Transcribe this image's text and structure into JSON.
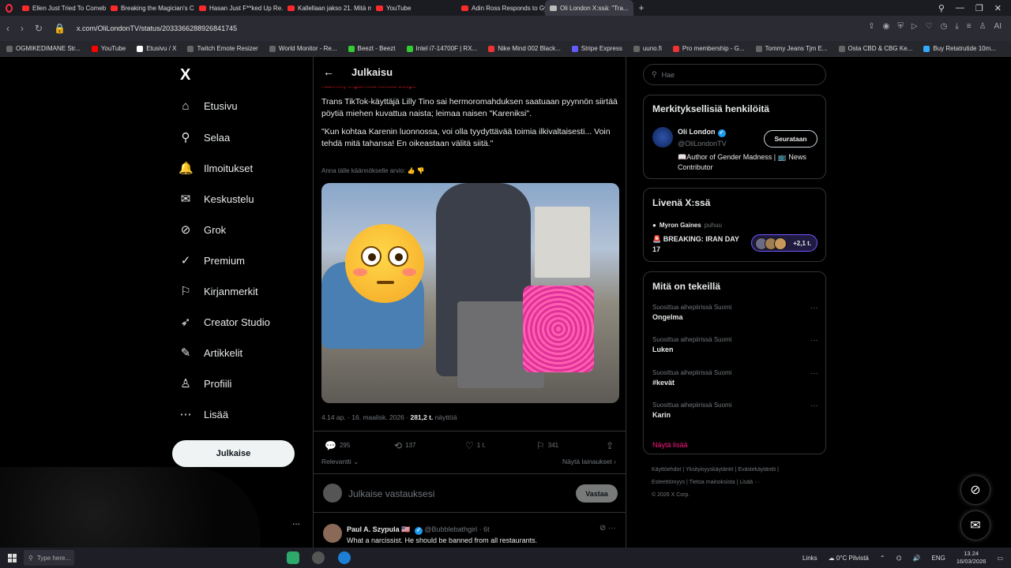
{
  "browser": {
    "tabs": [
      {
        "label": "Ellen Just Tried To Comeb..."
      },
      {
        "label": "Breaking the Magician's C..."
      },
      {
        "label": "Hasan Just F**ked Up Re..."
      },
      {
        "label": "Kallellaan jakso 21. Mitä m..."
      },
      {
        "label": "YouTube"
      },
      {
        "label": "Adin Ross Responds to Gy..."
      },
      {
        "label": "Oli London X:ssä: \"Tra..."
      }
    ],
    "url": "x.com/OliLondonTV/status/2033366288926841745",
    "bookmarks": [
      "OGMIKEDIMANE Str...",
      "YouTube",
      "Etusivu / X",
      "Twitch Emote Resizer",
      "World Monitor - Re...",
      "Beezt - Beezt",
      "Intel i7-14700F | RX...",
      "Nike Mind 002 Black...",
      "Stripe Express",
      "uuno.fi",
      "Pro membership - G...",
      "Tommy Jeans Tjm E...",
      "Osta CBD & CBG Ke...",
      "Buy Retatrutide 10m..."
    ],
    "ai_label": "AI"
  },
  "sidebar": {
    "logo": "X",
    "items": [
      {
        "label": "Etusivu",
        "icon": "⌂"
      },
      {
        "label": "Selaa",
        "icon": "⚲"
      },
      {
        "label": "Ilmoitukset",
        "icon": "🔔"
      },
      {
        "label": "Keskustelu",
        "icon": "✉"
      },
      {
        "label": "Grok",
        "icon": "⊘"
      },
      {
        "label": "Premium",
        "icon": "✓"
      },
      {
        "label": "Kirjanmerkit",
        "icon": "⚐"
      },
      {
        "label": "Creator Studio",
        "icon": "➶"
      },
      {
        "label": "Artikkelit",
        "icon": "✎"
      },
      {
        "label": "Profiili",
        "icon": "♙"
      },
      {
        "label": "Lisää",
        "icon": "⋯"
      }
    ],
    "post_button": "Julkaise",
    "more": "..."
  },
  "post": {
    "header_title": "Julkaisu",
    "translated_note": "Käännetty englannista kielestä Google",
    "text_p1": "Trans TikTok-käyttäjä Lilly Tino sai hermoromahduksen saatuaan pyynnön siirtää pöytiä miehen kuvattua naista; leimaa naisen \"Kareniksi\".",
    "text_p2": "\"Kun kohtaa Karenin luonnossa, voi olla tyydyttävää toimia ilkivaltaisesti... Voin tehdä mitä tahansa! En oikeastaan välitä siitä.\"",
    "rate_translation": "Anna tälle käännökselle arvio:",
    "timestamp": "4.14 ap. · 16. maalisk. 2026 ·",
    "views": "281,2 t.",
    "views_label": "näyttöä",
    "replies": "295",
    "reposts": "137",
    "likes": "1 t.",
    "bookmarks": "341",
    "sort_label": "Relevantti",
    "show_quotes": "Näytä lainaukset",
    "reply_placeholder": "Julkaise vastauksesi",
    "reply_button": "Vastaa"
  },
  "comment": {
    "name": "Paul A. Szypula 🇺🇸",
    "handle": "@Bubblebathgirl · 6t",
    "text": "What a narcissist. He should be banned from all restaurants."
  },
  "right": {
    "search_placeholder": "Hae",
    "relevant_title": "Merkityksellisiä henkilöitä",
    "person_name": "Oli London",
    "person_handle": "@OliLondonTV",
    "follow_label": "Seurataan",
    "person_bio": "📖Author of Gender Madness | 📺 News Contributor",
    "live_title": "Livenä X:ssä",
    "live_host": "Myron Gaines",
    "live_speaking": "puhuu",
    "live_topic": "🚨 BREAKING: IRAN DAY 17",
    "live_count": "+2,1 t.",
    "trending_title": "Mitä on tekeillä",
    "trends": [
      {
        "context": "Suosittua aihepiirissä Suomi",
        "name": "Ongelma"
      },
      {
        "context": "Suosittua aihepiirissä Suomi",
        "name": "Luken"
      },
      {
        "context": "Suosittua aihepiirissä Suomi",
        "name": "#kevät"
      },
      {
        "context": "Suosittua aihepiirissä Suomi",
        "name": "Karin"
      }
    ],
    "show_more": "Näytä lisää",
    "footer_line1": "Käyttöehdot  |  Yksityisyyskäytäntö  |  Evästekäytäntö  |",
    "footer_line2": "Esteettömyys  |  Tietoa mainoksista  |  Lisää ···",
    "footer_line3": "© 2026 X Corp."
  },
  "taskbar": {
    "search_label": "Type here...",
    "links": "Links",
    "weather": "0°C  Pilvistä",
    "lang": "ENG",
    "time": "13.24",
    "date": "16/03/2026"
  },
  "colors": {
    "accent_pink": "#f91880",
    "verified_blue": "#1d9bf0",
    "live_purple": "#7856ff"
  }
}
